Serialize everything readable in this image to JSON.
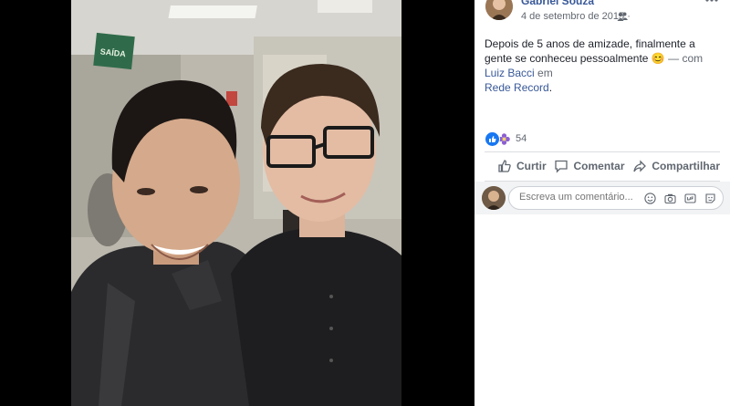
{
  "post": {
    "author": "Gabriel Souza",
    "date": "4 de setembro de 2015",
    "separator": "·",
    "audience_icon": "friends-icon",
    "caption": {
      "text": "Depois de 5 anos de amizade, finalmente a gente se conheceu pessoalmente",
      "emoji": "😊",
      "with_prefix": "— com",
      "tagged": "Luiz Bacci",
      "in_word": "em",
      "place": "Rede Record",
      "end": "."
    },
    "reactions": {
      "count": "54",
      "icons": [
        "like-icon",
        "flower-icon"
      ],
      "colors": {
        "like": "#1877f2",
        "flower": "#8b5fd1"
      }
    },
    "actions": {
      "like": "Curtir",
      "comment": "Comentar",
      "share": "Compartilhar"
    },
    "comment_box": {
      "placeholder": "Escreva um comentário..."
    }
  },
  "photo": {
    "sign_text": "SAÍDA"
  },
  "colors": {
    "link": "#385898",
    "text": "#1d2129",
    "secondary": "#616770",
    "action": "#606770"
  }
}
